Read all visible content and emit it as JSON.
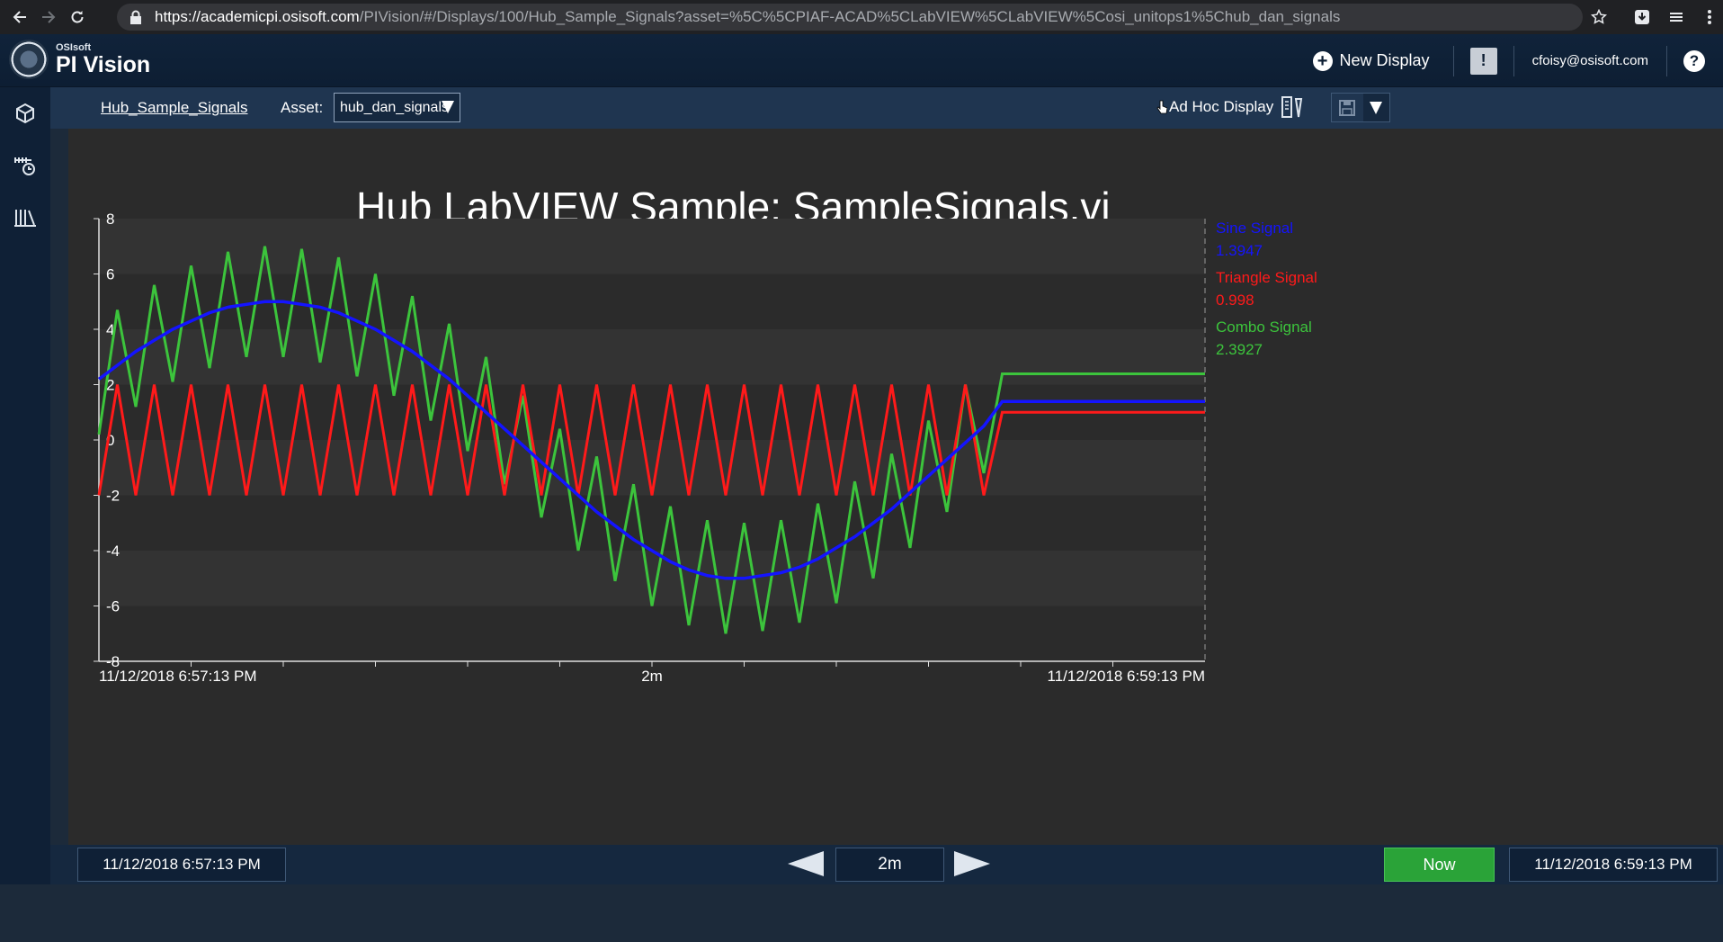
{
  "browser": {
    "url_host": "https://academicpi.osisoft.com",
    "url_rest": "/PIVision/#/Displays/100/Hub_Sample_Signals?asset=%5C%5CPIAF-ACAD%5CLabVIEW%5CLabVIEW%5Cosi_unitops1%5Chub_dan_signals"
  },
  "header": {
    "brand_small": "OSIsoft",
    "brand_name": "PI Vision",
    "new_display": "New Display",
    "alert": "!",
    "user": "cfoisy@osisoft.com",
    "help": "?"
  },
  "toolbar": {
    "display_name": "Hub_Sample_Signals",
    "asset_label": "Asset:",
    "asset_value": "hub_dan_signals",
    "adhoc_label": "Ad Hoc Display"
  },
  "display": {
    "title": "Hub LabVIEW Sample: SampleSignals.vi"
  },
  "chart_data": {
    "type": "line",
    "x_start_label": "11/12/2018 6:57:13 PM",
    "x_mid_label": "2m",
    "x_end_label": "11/12/2018 6:59:13 PM",
    "x_unit": "seconds",
    "xlim": [
      0,
      120
    ],
    "ylim": [
      -8,
      8
    ],
    "yticks": [
      8,
      6,
      4,
      2,
      0,
      -2,
      -4,
      -6,
      -8
    ],
    "grid": "horizontal bands",
    "legend_position": "right",
    "series": [
      {
        "name": "Sine Signal",
        "color": "#1414ff",
        "current_value": "1.3947",
        "x": [
          0,
          2,
          4,
          6,
          8,
          10,
          12,
          14,
          16,
          18,
          20,
          22,
          24,
          26,
          28,
          30,
          32,
          34,
          36,
          38,
          40,
          42,
          44,
          46,
          48,
          50,
          52,
          54,
          56,
          58,
          60,
          62,
          64,
          66,
          68,
          70,
          72,
          74,
          76,
          78,
          80,
          82,
          84,
          86,
          88,
          90,
          92,
          94,
          96,
          98,
          120
        ],
        "y": [
          2.2,
          2.7,
          3.2,
          3.6,
          4.0,
          4.3,
          4.6,
          4.8,
          4.9,
          5.0,
          5.0,
          4.9,
          4.8,
          4.6,
          4.3,
          4.0,
          3.6,
          3.2,
          2.7,
          2.2,
          1.6,
          1.0,
          0.4,
          -0.2,
          -0.8,
          -1.4,
          -2.0,
          -2.6,
          -3.1,
          -3.6,
          -4.0,
          -4.4,
          -4.7,
          -4.9,
          -5.0,
          -5.0,
          -4.9,
          -4.8,
          -4.6,
          -4.3,
          -3.9,
          -3.5,
          -3.0,
          -2.5,
          -1.9,
          -1.3,
          -0.7,
          -0.1,
          0.5,
          1.39,
          1.39
        ]
      },
      {
        "name": "Triangle Signal",
        "color": "#ff1a1a",
        "current_value": "0.998",
        "x": [
          0,
          2,
          4,
          6,
          8,
          10,
          12,
          14,
          16,
          18,
          20,
          22,
          24,
          26,
          28,
          30,
          32,
          34,
          36,
          38,
          40,
          42,
          44,
          46,
          48,
          50,
          52,
          54,
          56,
          58,
          60,
          62,
          64,
          66,
          68,
          70,
          72,
          74,
          76,
          78,
          80,
          82,
          84,
          86,
          88,
          90,
          92,
          94,
          96,
          98,
          120
        ],
        "y": [
          -2,
          2,
          -2,
          2,
          -2,
          2,
          -2,
          2,
          -2,
          2,
          -2,
          2,
          -2,
          2,
          -2,
          2,
          -2,
          2,
          -2,
          2,
          -2,
          2,
          -2,
          2,
          -2,
          2,
          -2,
          2,
          -2,
          2,
          -2,
          2,
          -2,
          2,
          -2,
          2,
          -2,
          2,
          -2,
          2,
          -2,
          2,
          -2,
          2,
          -2,
          2,
          -2,
          2,
          -2,
          1.0,
          1.0
        ]
      },
      {
        "name": "Combo Signal",
        "color": "#3cc43c",
        "current_value": "2.3927",
        "x": [
          0,
          2,
          4,
          6,
          8,
          10,
          12,
          14,
          16,
          18,
          20,
          22,
          24,
          26,
          28,
          30,
          32,
          34,
          36,
          38,
          40,
          42,
          44,
          46,
          48,
          50,
          52,
          54,
          56,
          58,
          60,
          62,
          64,
          66,
          68,
          70,
          72,
          74,
          76,
          78,
          80,
          82,
          84,
          86,
          88,
          90,
          92,
          94,
          96,
          98,
          120
        ],
        "y": [
          0.2,
          4.7,
          1.2,
          5.6,
          2.1,
          6.3,
          2.6,
          6.8,
          3.0,
          7.0,
          3.0,
          6.9,
          2.8,
          6.6,
          2.3,
          6.0,
          1.6,
          5.2,
          0.7,
          4.2,
          -0.4,
          3.0,
          -1.6,
          1.6,
          -2.8,
          0.4,
          -4.0,
          -0.6,
          -5.1,
          -1.6,
          -6.0,
          -2.4,
          -6.7,
          -2.9,
          -7.0,
          -3.0,
          -6.9,
          -2.9,
          -6.6,
          -2.3,
          -5.9,
          -1.5,
          -5.0,
          -0.5,
          -3.9,
          0.7,
          -2.6,
          2.0,
          -1.2,
          2.39,
          2.39
        ]
      }
    ]
  },
  "timebar": {
    "start": "11/12/2018 6:57:13 PM",
    "duration": "2m",
    "now": "Now",
    "end": "11/12/2018 6:59:13 PM"
  },
  "icons": {
    "left_nav": [
      "cube-icon",
      "asset-trend-icon",
      "library-icon"
    ],
    "zoom": [
      "zoom-in-icon",
      "zoom-out-icon",
      "reset-zoom-icon"
    ]
  }
}
